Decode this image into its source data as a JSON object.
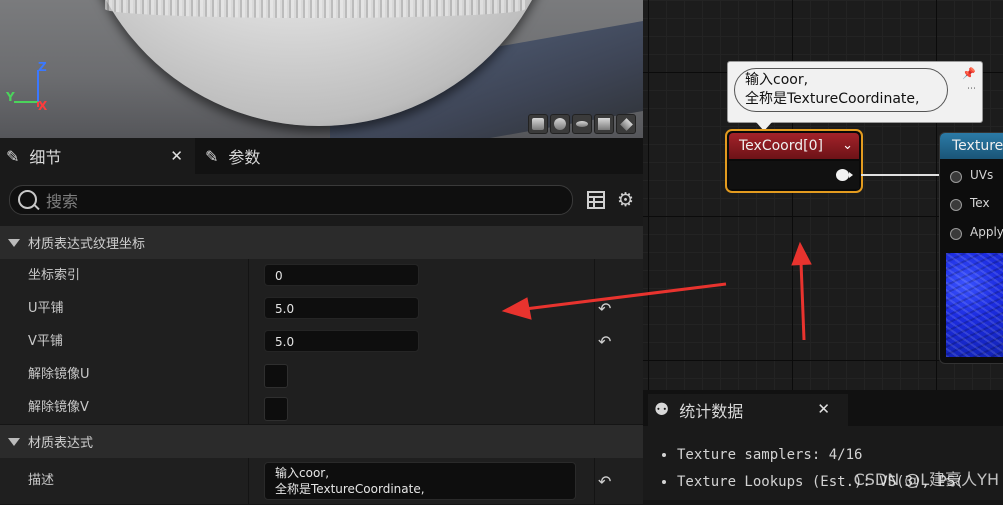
{
  "viewport": {
    "axes": {
      "x": "X",
      "y": "Y",
      "z": "Z"
    },
    "preview_shapes": [
      "cylinder-icon",
      "sphere-icon",
      "plane-icon",
      "cube-icon",
      "custom-mesh-icon"
    ]
  },
  "details_panel": {
    "tabs": [
      {
        "label": "细节",
        "icon": "pencil-icon",
        "active": true
      },
      {
        "label": "参数",
        "icon": "pencil-icon",
        "active": false
      }
    ],
    "search": {
      "placeholder": "搜索",
      "value": ""
    },
    "sections": [
      {
        "title": "材质表达式纹理坐标",
        "rows": [
          {
            "label": "坐标索引",
            "type": "number",
            "value": "0",
            "resettable": false
          },
          {
            "label": "U平铺",
            "type": "number",
            "value": "5.0",
            "resettable": true
          },
          {
            "label": "V平铺",
            "type": "number",
            "value": "5.0",
            "resettable": true
          },
          {
            "label": "解除镜像U",
            "type": "checkbox",
            "value": false,
            "resettable": false
          },
          {
            "label": "解除镜像V",
            "type": "checkbox",
            "value": false,
            "resettable": false
          }
        ]
      },
      {
        "title": "材质表达式",
        "rows": [
          {
            "label": "描述",
            "type": "text",
            "value_lines": [
              "输入coor,",
              "全称是TextureCoordinate,"
            ],
            "resettable": true
          }
        ]
      }
    ]
  },
  "graph": {
    "comment_bubble": {
      "lines": [
        "输入coor,",
        "全称是TextureCoordinate,"
      ]
    },
    "texcoord_node": {
      "title": "TexCoord[0]"
    },
    "texture_node": {
      "title": "Texture",
      "inputs": [
        "UVs",
        "Tex",
        "Apply"
      ]
    }
  },
  "stats_panel": {
    "tab_label": "统计数据",
    "lines": [
      "Texture samplers: 4/16",
      "Texture Lookups (Est.): VS(3), PS("
    ]
  },
  "watermark": "CSDN @L建豪人YH"
}
